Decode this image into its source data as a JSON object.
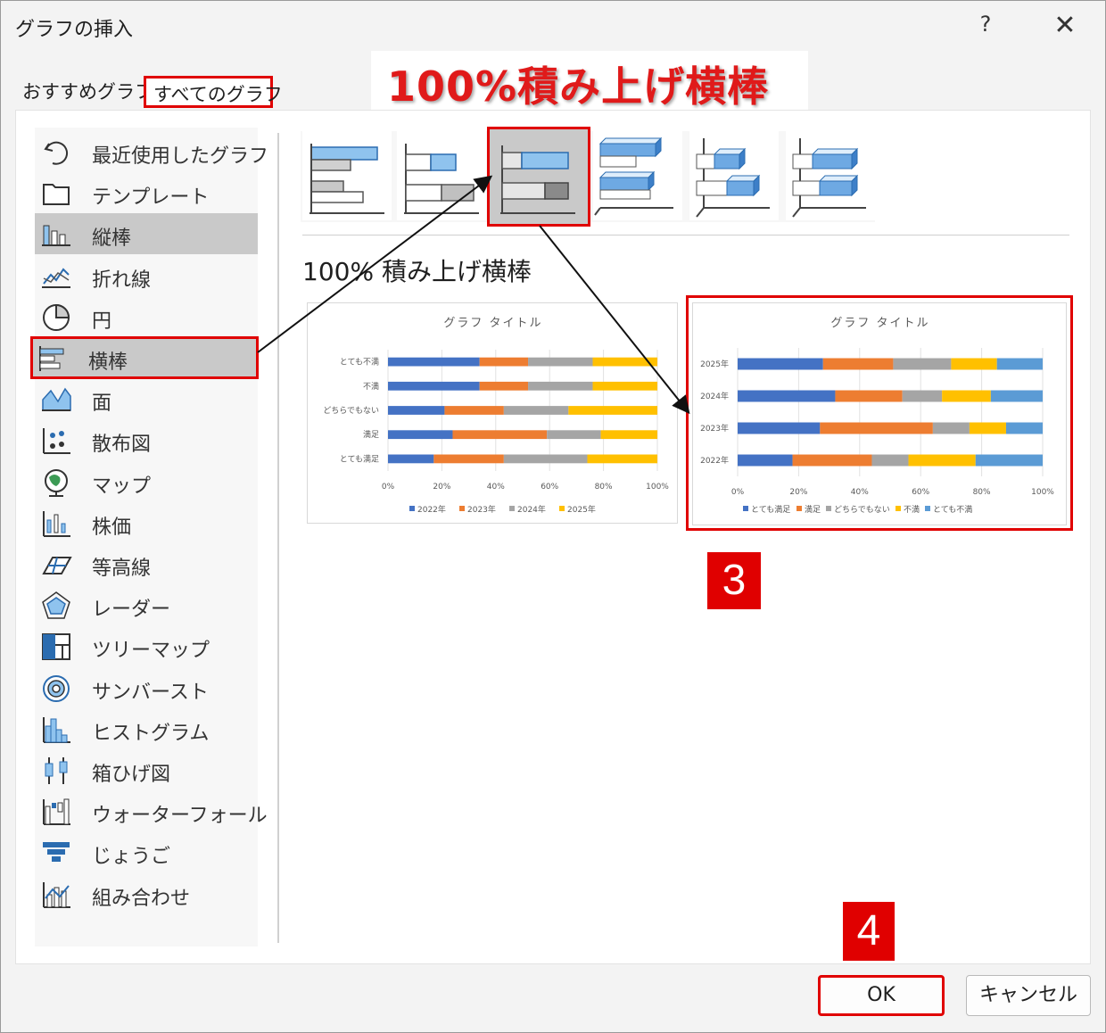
{
  "dialog": {
    "title": "グラフの挿入",
    "help": "?",
    "close": "✕"
  },
  "tabs": {
    "recommended": "おすすめグラフ",
    "all": "すべてのグラフ"
  },
  "annotation": {
    "banner": "100%積み上げ横棒",
    "step3": "3",
    "step4": "4"
  },
  "sidebar": {
    "items": [
      {
        "label": "最近使用したグラフ",
        "icon": "recent-icon"
      },
      {
        "label": "テンプレート",
        "icon": "folder-icon"
      },
      {
        "label": "縦棒",
        "icon": "column-chart-icon"
      },
      {
        "label": "折れ線",
        "icon": "line-chart-icon"
      },
      {
        "label": "円",
        "icon": "pie-chart-icon"
      },
      {
        "label": "横棒",
        "icon": "bar-chart-icon"
      },
      {
        "label": "面",
        "icon": "area-chart-icon"
      },
      {
        "label": "散布図",
        "icon": "scatter-chart-icon"
      },
      {
        "label": "マップ",
        "icon": "map-icon"
      },
      {
        "label": "株価",
        "icon": "stock-chart-icon"
      },
      {
        "label": "等高線",
        "icon": "surface-chart-icon"
      },
      {
        "label": "レーダー",
        "icon": "radar-chart-icon"
      },
      {
        "label": "ツリーマップ",
        "icon": "treemap-icon"
      },
      {
        "label": "サンバースト",
        "icon": "sunburst-icon"
      },
      {
        "label": "ヒストグラム",
        "icon": "histogram-icon"
      },
      {
        "label": "箱ひげ図",
        "icon": "boxplot-icon"
      },
      {
        "label": "ウォーターフォール",
        "icon": "waterfall-icon"
      },
      {
        "label": "じょうご",
        "icon": "funnel-icon"
      },
      {
        "label": "組み合わせ",
        "icon": "combo-chart-icon"
      }
    ]
  },
  "subtype": {
    "title": "100% 積み上げ横棒"
  },
  "previews": {
    "p1": {
      "title": "グラフ タイトル",
      "categories": [
        "とても不満",
        "不満",
        "どちらでもない",
        "満足",
        "とても満足"
      ],
      "series": [
        {
          "name": "2022年",
          "color": "#4472c4",
          "values": [
            34,
            34,
            21,
            24,
            17
          ]
        },
        {
          "name": "2023年",
          "color": "#ed7d31",
          "values": [
            18,
            18,
            22,
            35,
            26
          ]
        },
        {
          "name": "2024年",
          "color": "#a5a5a5",
          "values": [
            24,
            24,
            24,
            20,
            31
          ]
        },
        {
          "name": "2025年",
          "color": "#ffc000",
          "values": [
            24,
            24,
            33,
            21,
            26
          ]
        }
      ],
      "ticks": [
        "0%",
        "20%",
        "40%",
        "60%",
        "80%",
        "100%"
      ]
    },
    "p2": {
      "title": "グラフ タイトル",
      "categories": [
        "2025年",
        "2024年",
        "2023年",
        "2022年"
      ],
      "series": [
        {
          "name": "とても満足",
          "color": "#4472c4",
          "values": [
            28,
            32,
            27,
            18
          ]
        },
        {
          "name": "満足",
          "color": "#ed7d31",
          "values": [
            23,
            22,
            37,
            26
          ]
        },
        {
          "name": "どちらでもない",
          "color": "#a5a5a5",
          "values": [
            19,
            13,
            12,
            12
          ]
        },
        {
          "name": "不満",
          "color": "#ffc000",
          "values": [
            15,
            16,
            12,
            22
          ]
        },
        {
          "name": "とても不満",
          "color": "#5b9bd5",
          "values": [
            15,
            17,
            12,
            22
          ]
        }
      ],
      "ticks": [
        "0%",
        "20%",
        "40%",
        "60%",
        "80%",
        "100%"
      ]
    }
  },
  "buttons": {
    "ok": "OK",
    "cancel": "キャンセル"
  },
  "colors": {
    "highlight": "#e00000",
    "selected": "#c9c9c9"
  }
}
